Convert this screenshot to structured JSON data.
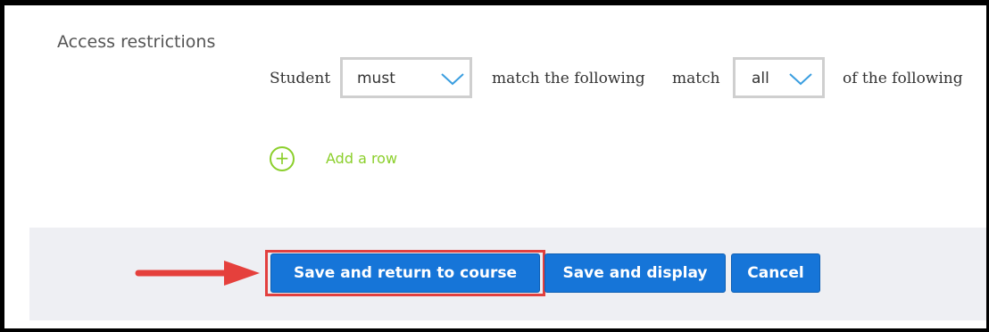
{
  "section": {
    "label": "Access restrictions"
  },
  "restriction": {
    "prefix": "Student",
    "must_select": {
      "value": "must"
    },
    "middle": "match the following",
    "match_word": "match",
    "all_select": {
      "value": "all"
    },
    "suffix": "of the following"
  },
  "add_row": {
    "icon": "plus-circle-icon",
    "label": "Add a row"
  },
  "buttons": {
    "save_return": "Save and return to course",
    "save_display": "Save and display",
    "cancel": "Cancel"
  },
  "colors": {
    "primary_button": "#1675d8",
    "add_green": "#8bcf2b",
    "highlight_red": "#e2403e",
    "arrow_red": "#e5403c",
    "footer_bg": "#eeeff3",
    "chevron": "#3a9ee0"
  }
}
